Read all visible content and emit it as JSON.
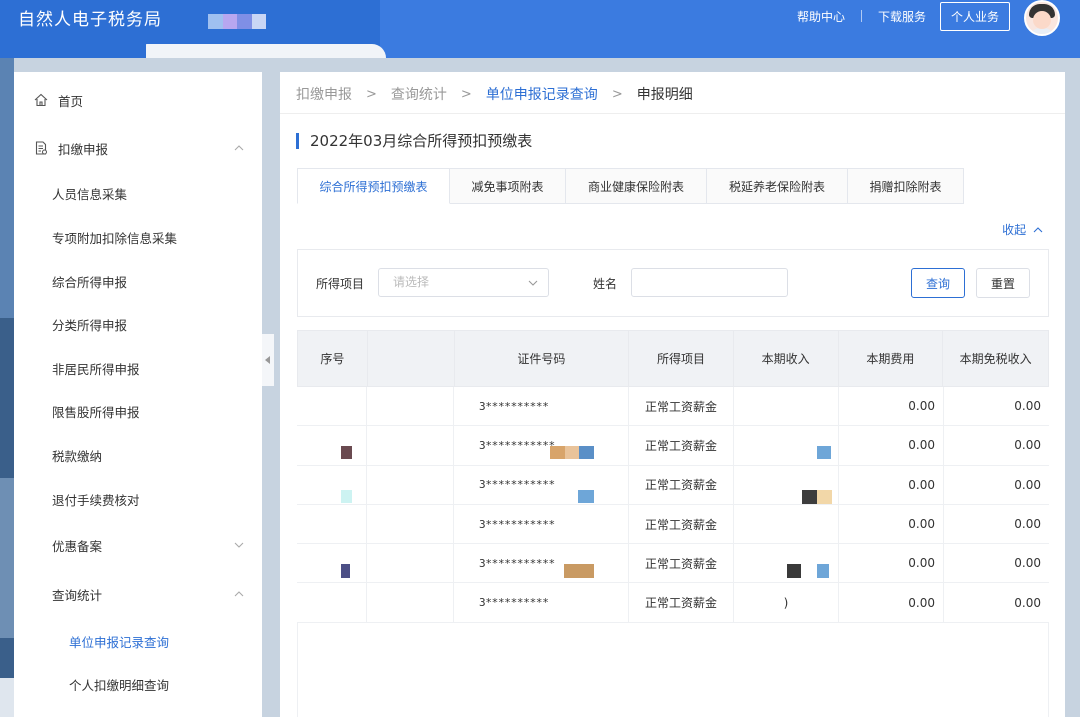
{
  "header": {
    "logo": "自然人电子税务局",
    "links": [
      "帮助中心",
      "下载服务"
    ],
    "user_button": "个人业务"
  },
  "sidebar": {
    "home": "首页",
    "declare": "扣缴申报",
    "declare_items": [
      "人员信息采集",
      "专项附加扣除信息采集",
      "综合所得申报",
      "分类所得申报",
      "非居民所得申报",
      "限售股所得申报",
      "税款缴纳",
      "退付手续费核对"
    ],
    "discount": "优惠备案",
    "query": "查询统计",
    "query_items": [
      "单位申报记录查询",
      "个人扣缴明细查询"
    ]
  },
  "breadcrumb": [
    "扣缴申报",
    "查询统计",
    "单位申报记录查询",
    "申报明细"
  ],
  "page_title": "2022年03月综合所得预扣预缴表",
  "tabs": [
    "综合所得预扣预缴表",
    "减免事项附表",
    "商业健康保险附表",
    "税延养老保险附表",
    "捐赠扣除附表"
  ],
  "collapse_label": "收起",
  "filter": {
    "item_label": "所得项目",
    "item_placeholder": "请选择",
    "name_label": "姓名",
    "name_value": "",
    "query_button": "查询",
    "reset_button": "重置"
  },
  "table": {
    "columns": [
      "序号",
      "",
      "证件号码",
      "所得项目",
      "本期收入",
      "本期费用",
      "本期免税收入"
    ],
    "rows": [
      {
        "id": "3**********",
        "item": "正常工资薪金",
        "fee": "0.00",
        "free": "0.00",
        "income": ""
      },
      {
        "id": "3***********",
        "item": "正常工资薪金",
        "fee": "0.00",
        "free": "0.00",
        "income": ""
      },
      {
        "id": "3***********",
        "item": "正常工资薪金",
        "fee": "0.00",
        "free": "0.00",
        "income": ""
      },
      {
        "id": "3***********",
        "item": "正常工资薪金",
        "fee": "0.00",
        "free": "0.00",
        "income": ""
      },
      {
        "id": "3***********",
        "item": "正常工资薪金",
        "fee": "0.00",
        "free": "0.00",
        "income": ""
      },
      {
        "id": "3**********",
        "item": "正常工资薪金",
        "fee": "0.00",
        "free": "0.00",
        "income": ")"
      }
    ]
  },
  "colors": {
    "brand": "#2d6fd4",
    "header_bg": "#2d6fd4"
  }
}
